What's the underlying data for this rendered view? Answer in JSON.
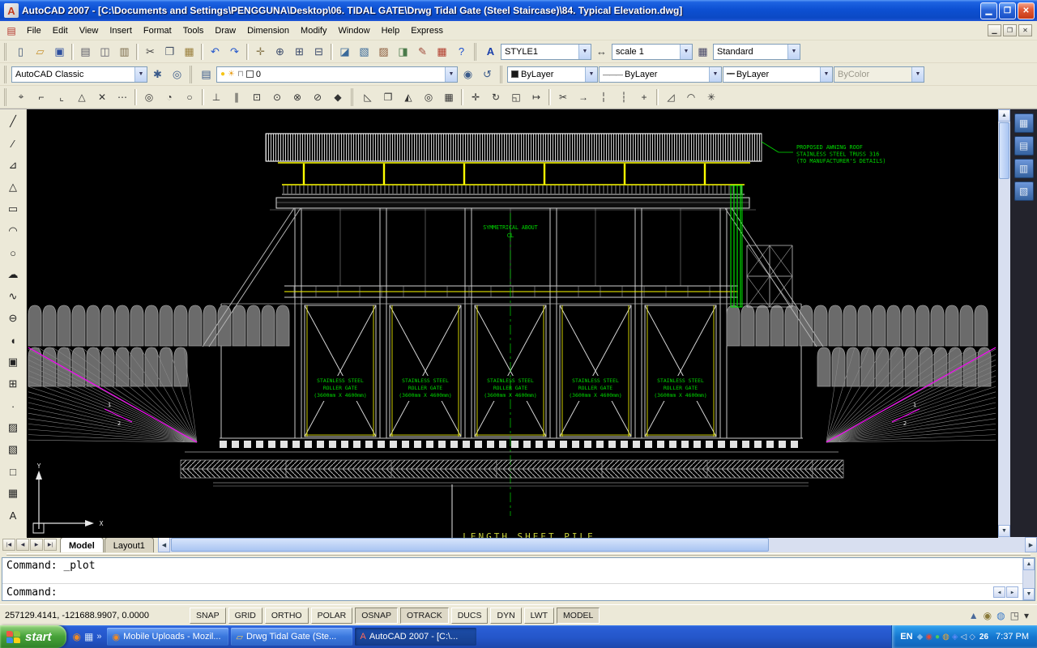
{
  "window": {
    "title": "AutoCAD 2007 - [C:\\Documents and Settings\\PENGGUNA\\Desktop\\06. TIDAL GATE\\Drwg Tidal Gate (Steel Staircase)\\84. Typical Elevation.dwg]",
    "app_icon_glyph": "A"
  },
  "ui": {
    "combo_arrow": "▼",
    "up": "▲",
    "down": "▼",
    "left": "◀",
    "right": "▶",
    "minimize": "▁",
    "restore": "❐",
    "close": "✕",
    "overflow": "»",
    "doc_icon_glyph": "▤"
  },
  "theme": {
    "titlebar_blue": "#0d50d2",
    "toolbar_face": "#ece9d8",
    "taskbar_blue": "#2456c9",
    "start_green": "#48a33a",
    "canvas_black": "#000000"
  },
  "menu": {
    "items": [
      "File",
      "Edit",
      "View",
      "Insert",
      "Format",
      "Tools",
      "Draw",
      "Dimension",
      "Modify",
      "Window",
      "Help",
      "Express"
    ]
  },
  "toolbar_standard": {
    "buttons": [
      {
        "name": "qnew-button",
        "glyph": "▯",
        "color": "#445a7a"
      },
      {
        "name": "open-button",
        "glyph": "▱",
        "color": "#c8922e"
      },
      {
        "name": "save-button",
        "glyph": "▣",
        "color": "#2d4f9e"
      },
      {
        "sep": true
      },
      {
        "name": "plot-button",
        "glyph": "▤",
        "color": "#5a5a66"
      },
      {
        "name": "plot-preview-button",
        "glyph": "◫",
        "color": "#5a5a66"
      },
      {
        "name": "publish-button",
        "glyph": "▥",
        "color": "#7a6a4a"
      },
      {
        "sep": true
      },
      {
        "name": "cut-button",
        "glyph": "✂",
        "color": "#444444"
      },
      {
        "name": "copy-button",
        "glyph": "❐",
        "color": "#445066"
      },
      {
        "name": "paste-button",
        "glyph": "▦",
        "color": "#997e3a"
      },
      {
        "sep": true
      },
      {
        "name": "undo-button",
        "glyph": "↶",
        "color": "#2255cc"
      },
      {
        "name": "redo-button",
        "glyph": "↷",
        "color": "#2255cc"
      },
      {
        "sep": true
      },
      {
        "name": "pan-button",
        "glyph": "✛",
        "color": "#8a7a50"
      },
      {
        "name": "zoom-realtime-button",
        "glyph": "⊕",
        "color": "#3a4a6a"
      },
      {
        "name": "zoom-window-button",
        "glyph": "⊞",
        "color": "#3a4a6a"
      },
      {
        "name": "zoom-previous-button",
        "glyph": "⊟",
        "color": "#3a4a6a"
      },
      {
        "sep": true
      },
      {
        "name": "properties-button",
        "glyph": "◪",
        "color": "#3a6a9a"
      },
      {
        "name": "designcenter-button",
        "glyph": "▧",
        "color": "#3a6a9a"
      },
      {
        "name": "tool-palettes-button",
        "glyph": "▨",
        "color": "#8a5a3a"
      },
      {
        "name": "sheet-set-manager-button",
        "glyph": "◨",
        "color": "#4a7a4a"
      },
      {
        "name": "markup-set-manager-button",
        "glyph": "✎",
        "color": "#a04a3a"
      },
      {
        "name": "quickcalc-button",
        "glyph": "▦",
        "color": "#b03a2a"
      },
      {
        "name": "help-button",
        "glyph": "?",
        "color": "#1a4fd0"
      }
    ]
  },
  "styles_toolbar": {
    "text_style_icon_glyph": "A",
    "text_style": "STYLE1",
    "dim_style_icon_glyph": "↔",
    "dim_style": "scale 1",
    "table_style_icon_glyph": "▦",
    "table_style": "Standard"
  },
  "layers_toolbar": {
    "workspace": "AutoCAD Classic",
    "workspace_buttons": [
      {
        "name": "workspace-settings-button",
        "glyph": "✱",
        "color": "#3a5a8a"
      },
      {
        "name": "save-workspace-button",
        "glyph": "◎",
        "color": "#3a5a8a"
      }
    ],
    "layer_manager_buttons": [
      {
        "name": "layer-properties-manager-button",
        "glyph": "▤",
        "color": "#3a5a8a"
      }
    ],
    "bulb_glyph": "●",
    "freeze_glyph": "☀",
    "lock_glyph": "⊓",
    "layer_name": "0",
    "layer_state_buttons": [
      {
        "name": "make-object-layer-current-button",
        "glyph": "◉",
        "color": "#3a5a8a"
      },
      {
        "name": "layer-previous-button",
        "glyph": "↺",
        "color": "#3a5a8a"
      }
    ],
    "color": "ByLayer",
    "linetype_glyph": "———",
    "linetype": "ByLayer",
    "lineweight_glyph": "━━",
    "lineweight": "ByLayer",
    "plot_style": "ByColor"
  },
  "toolbar_osnap": {
    "buttons": [
      {
        "name": "temporary-track-point-button",
        "glyph": "⌖",
        "color": "#333333"
      },
      {
        "name": "snap-from-button",
        "glyph": "⌐",
        "color": "#333333"
      },
      {
        "name": "snap-to-endpoint-button",
        "glyph": "⌞",
        "color": "#333333"
      },
      {
        "name": "snap-to-midpoint-button",
        "glyph": "△",
        "color": "#333333"
      },
      {
        "name": "snap-to-intersection-button",
        "glyph": "✕",
        "color": "#333333"
      },
      {
        "name": "snap-to-extension-button",
        "glyph": "⋯",
        "color": "#333333"
      },
      {
        "sep": true
      },
      {
        "name": "snap-to-center-button",
        "glyph": "◎",
        "color": "#333333"
      },
      {
        "name": "snap-to-quadrant-button",
        "glyph": "◔",
        "color": "#333333"
      },
      {
        "name": "snap-to-tangent-button",
        "glyph": "○",
        "color": "#333333"
      },
      {
        "sep": true
      },
      {
        "name": "snap-to-perpendicular-button",
        "glyph": "⊥",
        "color": "#333333"
      },
      {
        "name": "snap-to-parallel-button",
        "glyph": "∥",
        "color": "#333333"
      },
      {
        "name": "snap-to-insert-button",
        "glyph": "⊡",
        "color": "#333333"
      },
      {
        "name": "snap-to-node-button",
        "glyph": "⊙",
        "color": "#333333"
      },
      {
        "name": "snap-to-nearest-button",
        "glyph": "⊗",
        "color": "#333333"
      },
      {
        "name": "snap-to-none-button",
        "glyph": "⊘",
        "color": "#333333"
      },
      {
        "name": "osnap-settings-button",
        "glyph": "◆",
        "color": "#333333"
      }
    ]
  },
  "toolbar_modify": {
    "buttons": [
      {
        "name": "erase-button",
        "glyph": "◺",
        "color": "#333333"
      },
      {
        "name": "copy-object-button",
        "glyph": "❐",
        "color": "#333333"
      },
      {
        "name": "mirror-button",
        "glyph": "◭",
        "color": "#333333"
      },
      {
        "name": "offset-button",
        "glyph": "◎",
        "color": "#333333"
      },
      {
        "name": "array-button",
        "glyph": "▦",
        "color": "#333333"
      },
      {
        "sep": true
      },
      {
        "name": "move-button",
        "glyph": "✛",
        "color": "#333333"
      },
      {
        "name": "rotate-button",
        "glyph": "↻",
        "color": "#333333"
      },
      {
        "name": "scale-button",
        "glyph": "◱",
        "color": "#333333"
      },
      {
        "name": "stretch-button",
        "glyph": "↦",
        "color": "#333333"
      },
      {
        "sep": true
      },
      {
        "name": "trim-button",
        "glyph": "✂",
        "color": "#333333"
      },
      {
        "name": "extend-button",
        "glyph": "→",
        "color": "#333333"
      },
      {
        "name": "break-at-point-button",
        "glyph": "╎",
        "color": "#333333"
      },
      {
        "name": "break-button",
        "glyph": "┆",
        "color": "#333333"
      },
      {
        "name": "join-button",
        "glyph": "+",
        "color": "#333333"
      },
      {
        "sep": true
      },
      {
        "name": "chamfer-button",
        "glyph": "◿",
        "color": "#333333"
      },
      {
        "name": "fillet-button",
        "glyph": "◠",
        "color": "#333333"
      },
      {
        "name": "explode-button",
        "glyph": "✳",
        "color": "#333333"
      }
    ]
  },
  "draw_toolbar": {
    "buttons": [
      {
        "name": "line-tool-button",
        "glyph": "╱"
      },
      {
        "name": "construction-line-tool-button",
        "glyph": "∕"
      },
      {
        "name": "polyline-tool-button",
        "glyph": "⊿"
      },
      {
        "name": "polygon-tool-button",
        "glyph": "△"
      },
      {
        "name": "rectangle-tool-button",
        "glyph": "▭"
      },
      {
        "name": "arc-tool-button",
        "glyph": "◠"
      },
      {
        "name": "circle-tool-button",
        "glyph": "○"
      },
      {
        "name": "revision-cloud-tool-button",
        "glyph": "☁"
      },
      {
        "name": "spline-tool-button",
        "glyph": "∿"
      },
      {
        "name": "ellipse-tool-button",
        "glyph": "⊖"
      },
      {
        "name": "ellipse-arc-tool-button",
        "glyph": "◖"
      },
      {
        "name": "insert-block-tool-button",
        "glyph": "▣"
      },
      {
        "name": "make-block-tool-button",
        "glyph": "⊞"
      },
      {
        "name": "point-tool-button",
        "glyph": "∙"
      },
      {
        "name": "hatch-tool-button",
        "glyph": "▨"
      },
      {
        "name": "gradient-tool-button",
        "glyph": "▧"
      },
      {
        "name": "region-tool-button",
        "glyph": "□"
      },
      {
        "name": "table-tool-button",
        "glyph": "▦"
      },
      {
        "name": "multiline-text-tool-button",
        "glyph": "A"
      }
    ]
  },
  "right_toolbar": {
    "buttons": [
      {
        "name": "object-snap-toolbar-button",
        "glyph": "▦"
      },
      {
        "name": "ucs-toolbar-button",
        "glyph": "▤"
      },
      {
        "name": "view-toolbar-button",
        "glyph": "▥"
      },
      {
        "name": "orbit-toolbar-button",
        "glyph": "▧"
      }
    ]
  },
  "tabs": {
    "nav": [
      {
        "name": "tab-first-button",
        "glyph": "|◀"
      },
      {
        "name": "tab-prev-button",
        "glyph": "◀"
      },
      {
        "name": "tab-next-button",
        "glyph": "▶"
      },
      {
        "name": "tab-last-button",
        "glyph": "▶|"
      }
    ],
    "items": [
      {
        "name": "tab-model",
        "label": "Model",
        "active": true
      },
      {
        "name": "tab-layout1",
        "label": "Layout1",
        "active": false
      }
    ]
  },
  "command": {
    "history": "Command: _plot",
    "prompt": "Command:"
  },
  "status_bar": {
    "coordinates": "257129.4141, -121688.9907, 0.0000",
    "toggles": [
      {
        "name": "snap-toggle",
        "label": "SNAP",
        "pressed": false
      },
      {
        "name": "grid-toggle",
        "label": "GRID",
        "pressed": false
      },
      {
        "name": "ortho-toggle",
        "label": "ORTHO",
        "pressed": false
      },
      {
        "name": "polar-toggle",
        "label": "POLAR",
        "pressed": false
      },
      {
        "name": "osnap-toggle",
        "label": "OSNAP",
        "pressed": true
      },
      {
        "name": "otrack-toggle",
        "label": "OTRACK",
        "pressed": true
      },
      {
        "name": "ducs-toggle",
        "label": "DUCS",
        "pressed": false
      },
      {
        "name": "dyn-toggle",
        "label": "DYN",
        "pressed": false
      },
      {
        "name": "lwt-toggle",
        "label": "LWT",
        "pressed": false
      },
      {
        "name": "model-toggle",
        "label": "MODEL",
        "pressed": true
      }
    ],
    "tray_icons": [
      {
        "name": "annotation-scale-status-icon",
        "glyph": "▲",
        "color": "#4a6a9a"
      },
      {
        "name": "toolbar-lock-status-icon",
        "glyph": "◉",
        "color": "#8a7a3a"
      },
      {
        "name": "communication-center-status-icon",
        "glyph": "◍",
        "color": "#3a7ac8"
      },
      {
        "name": "clean-screen-status-icon",
        "glyph": "◳",
        "color": "#555555"
      },
      {
        "name": "status-menu-arrow-icon",
        "glyph": "▾",
        "color": "#333333"
      }
    ]
  },
  "taskbar": {
    "start_label": "start",
    "quick_launch": [
      {
        "name": "browser-quicklaunch-icon",
        "glyph": "◉",
        "color": "#f08a24"
      },
      {
        "name": "show-desktop-quicklaunch-icon",
        "glyph": "▦",
        "color": "#cfe0f7"
      }
    ],
    "tasks": [
      {
        "name": "task-firefox-mobile-uploads",
        "glyph": "◉",
        "color": "#f08a24",
        "label": "Mobile Uploads - Mozil...",
        "active": false
      },
      {
        "name": "task-folder-drwg-tidal-gate",
        "glyph": "▱",
        "color": "#f5cf5a",
        "label": "Drwg Tidal Gate (Ste...",
        "active": false
      },
      {
        "name": "task-autocad-2007",
        "glyph": "A",
        "color": "#ff6a5a",
        "label": "AutoCAD 2007 - [C:\\...",
        "active": true
      }
    ],
    "tray": {
      "lang": "EN",
      "icons": [
        {
          "name": "graphics-tray-icon",
          "glyph": "◆",
          "color": "#7cb5e8"
        },
        {
          "name": "antivirus-tray-icon",
          "glyph": "◉",
          "color": "#e04a3a"
        },
        {
          "name": "messenger-tray-icon",
          "glyph": "●",
          "color": "#4ac95a"
        },
        {
          "name": "update-tray-icon",
          "glyph": "◍",
          "color": "#f0a830"
        },
        {
          "name": "firewall-tray-icon",
          "glyph": "◈",
          "color": "#5a8af5"
        },
        {
          "name": "volume-tray-icon",
          "glyph": "◁",
          "color": "#e8e8e8"
        },
        {
          "name": "usb-tray-icon",
          "glyph": "◇",
          "color": "#c5d2ea"
        }
      ],
      "badge": "26",
      "time": "7:37 PM"
    }
  },
  "drawing": {
    "colors": {
      "background": "#000000",
      "line": "#d0d0d0",
      "yellow": "#ffff00",
      "green": "#00e000",
      "text_green": "#00d800",
      "magenta": "#ff00ff",
      "bottom_text": "#c8d23c",
      "arch_fill": "#6b6b6b",
      "hatch_gray": "#b8b8b8",
      "fan_gray": "#8a8a8a"
    },
    "annotations": {
      "roof_note_lines": [
        "PROPOSED AWNING ROOF",
        "STAINLESS STEEL TRUSS 316",
        "(TO MANUFACTURER'S DETAILS)"
      ],
      "symmetry_note": "SYMMETRICAL ABOUT",
      "symmetry_axis_label": "CL",
      "bottom_note": "LENGTH SHEET PILE",
      "slope_numerator": "1",
      "slope_denominator": "2"
    },
    "ucs": {
      "x_label": "X",
      "y_label": "Y"
    },
    "gates": [
      {
        "label_lines": [
          "STAINLESS STEEL",
          "ROLLER GATE",
          "(3600mm X 4600mm)"
        ]
      },
      {
        "label_lines": [
          "STAINLESS STEEL",
          "ROLLER GATE",
          "(3600mm X 4600mm)"
        ]
      },
      {
        "label_lines": [
          "STAINLESS STEEL",
          "ROLLER GATE",
          "(3600mm X 4600mm)"
        ]
      },
      {
        "label_lines": [
          "STAINLESS STEEL",
          "ROLLER GATE",
          "(3600mm X 4600mm)"
        ]
      },
      {
        "label_lines": [
          "STAINLESS STEEL",
          "ROLLER GATE",
          "(3600mm X 4600mm)"
        ]
      }
    ]
  }
}
